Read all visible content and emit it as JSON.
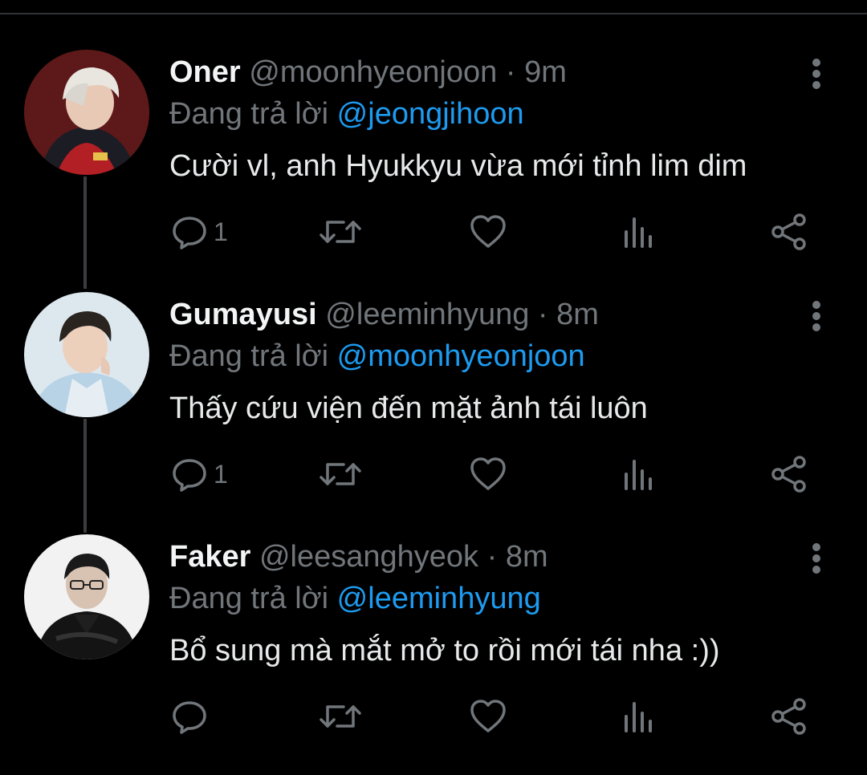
{
  "tweets": [
    {
      "display_name": "Oner",
      "handle": "@moonhyeonjoon",
      "separator": "·",
      "time": "9m",
      "reply_prefix": "Đang trả lời",
      "reply_to": "@jeongjihoon",
      "text": "Cười vl, anh Hyukkyu vừa mới tỉnh lim dim",
      "reply_count": "1",
      "avatar_bg": "#5a1a1a"
    },
    {
      "display_name": "Gumayusi",
      "handle": "@leeminhyung",
      "separator": "·",
      "time": "8m",
      "reply_prefix": "Đang trả lời",
      "reply_to": "@moonhyeonjoon",
      "text": "Thấy cứu viện đến mặt ảnh tái luôn",
      "reply_count": "1",
      "avatar_bg": "#d9e6ec"
    },
    {
      "display_name": "Faker",
      "handle": "@leesanghyeok",
      "separator": "·",
      "time": "8m",
      "reply_prefix": "Đang trả lời",
      "reply_to": "@leeminhyung",
      "text": "Bổ sung mà mắt mở to rồi mới tái nha :))",
      "reply_count": "",
      "avatar_bg": "#f2f2f2"
    }
  ],
  "icons": {
    "reply": "reply-icon",
    "retweet": "retweet-icon",
    "like": "heart-icon",
    "views": "views-icon",
    "share": "share-icon",
    "more": "more-icon"
  },
  "colors": {
    "background": "#000000",
    "text": "#e7e9ea",
    "muted": "#71767b",
    "link": "#1d9bf0",
    "thread_line": "#3a3d40"
  }
}
